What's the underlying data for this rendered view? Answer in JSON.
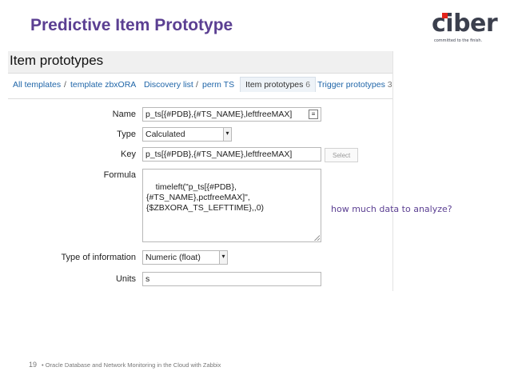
{
  "slide": {
    "title": "Predictive Item Prototype",
    "logo_word": "ciber",
    "logo_tagline": "committed to the finish.",
    "page_number": "19",
    "footer_text": "• Oracle Database and Network Monitoring in the Cloud with Zabbix",
    "annotation": "how much data to analyze?"
  },
  "screen": {
    "title": "Item prototypes",
    "breadcrumbs": [
      {
        "label": "All templates"
      },
      {
        "label": "template zbxORA"
      },
      {
        "label": "Discovery list"
      },
      {
        "label": "perm TS"
      },
      {
        "label": "Item prototypes",
        "count": "6"
      },
      {
        "label": "Trigger prototypes",
        "count": "3"
      }
    ],
    "separator": "/"
  },
  "form": {
    "name": {
      "label": "Name",
      "value": "p_ts[{#PDB},{#TS_NAME},leftfreeMAX]"
    },
    "type": {
      "label": "Type",
      "value": "Calculated"
    },
    "key": {
      "label": "Key",
      "value": "p_ts[{#PDB},{#TS_NAME},leftfreeMAX]",
      "button": "Select"
    },
    "formula": {
      "label": "Formula",
      "value": "timeleft(\"p_ts[{#PDB},\n{#TS_NAME},pctfreeMAX]\",\n{$ZBXORA_TS_LEFTTIME},,0)"
    },
    "type_of_information": {
      "label": "Type of information",
      "value": "Numeric (float)"
    },
    "units": {
      "label": "Units",
      "value": "s"
    }
  },
  "icons": {
    "macro": "macro-list-icon",
    "dropdown": "chevron-down-icon",
    "resize": "resize-grip-icon"
  },
  "colors": {
    "title_purple": "#5b3f92",
    "link_blue": "#1f65a8",
    "logo_red": "#e2231a"
  }
}
